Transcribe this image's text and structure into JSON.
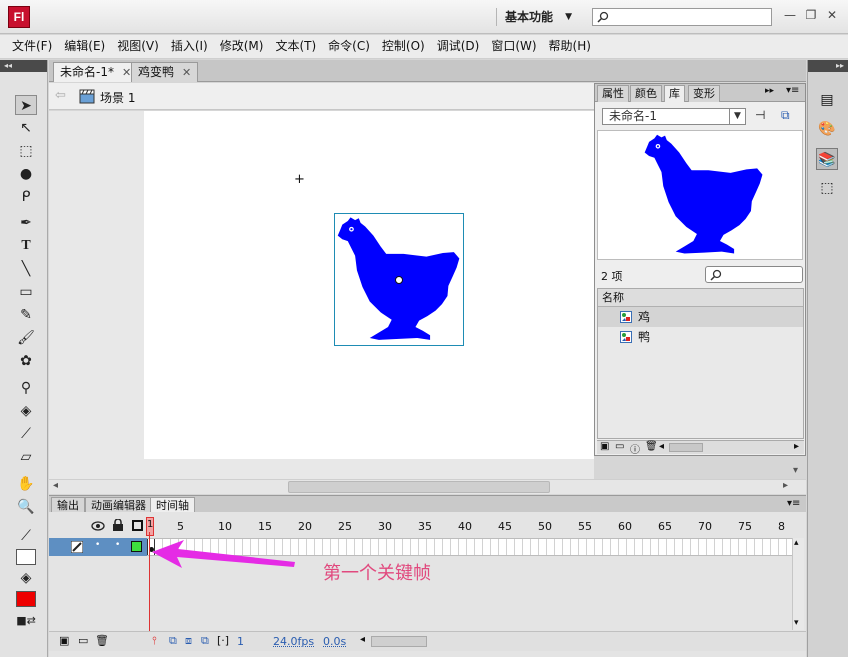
{
  "app": {
    "logo": "Fl",
    "workspace": "基本功能"
  },
  "menu": [
    "文件(F)",
    "编辑(E)",
    "视图(V)",
    "插入(I)",
    "修改(M)",
    "文本(T)",
    "命令(C)",
    "控制(O)",
    "调试(D)",
    "窗口(W)",
    "帮助(H)"
  ],
  "doc_tabs": [
    {
      "label": "未命名-1*"
    },
    {
      "label": "鸡变鸭"
    }
  ],
  "scene": {
    "label": "场景 1"
  },
  "panel": {
    "tabs": [
      "属性",
      "颜色",
      "库",
      "变形"
    ],
    "doc_select": "未命名-1",
    "item_count": "2 项",
    "list_header": "名称",
    "items": [
      "鸡",
      "鸭"
    ]
  },
  "bottom_tabs": [
    "输出",
    "动画编辑器",
    "时间轴"
  ],
  "timeline": {
    "current_frame_label": "1",
    "ruler": [
      "5",
      "10",
      "15",
      "20",
      "25",
      "30",
      "35",
      "40",
      "45",
      "50",
      "55",
      "60",
      "65",
      "70",
      "75",
      "8"
    ],
    "fps": "24.0fps",
    "frame": "1",
    "time": "0.0s"
  },
  "annotation": "第一个关键帧",
  "colors": {
    "chicken": "#0000ff",
    "annotation": "#e1497e",
    "layer": "#5e8fc2",
    "fill": "#ee0000",
    "stroke": "#000000"
  }
}
